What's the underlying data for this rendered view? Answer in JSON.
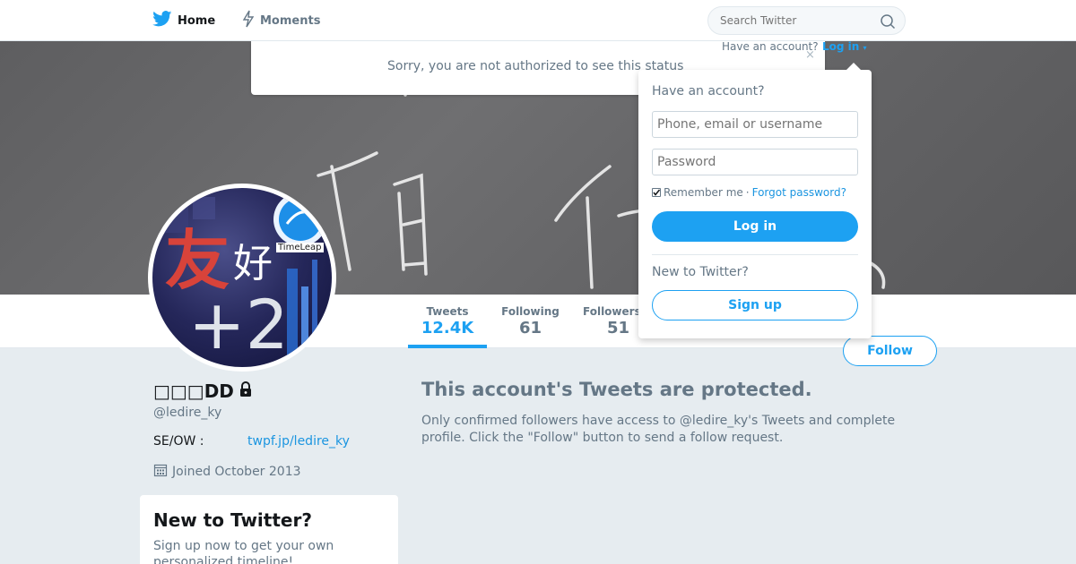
{
  "nav": {
    "home_label": "Home",
    "moments_label": "Moments",
    "search_placeholder": "Search Twitter"
  },
  "status": {
    "message": "Sorry, you are not authorized to see this status",
    "close_glyph": "×"
  },
  "login": {
    "have_account_inline": "Have an account?",
    "login_link": "Log in",
    "dropdown_title": "Have an account?",
    "username_placeholder": "Phone, email or username",
    "password_placeholder": "Password",
    "remember_me": "Remember me",
    "separator": "·",
    "forgot_password": "Forgot password?",
    "login_button": "Log in",
    "new_to_twitter": "New to Twitter?",
    "signup_button": "Sign up"
  },
  "stats": {
    "tweets": {
      "label": "Tweets",
      "value": "12.4K"
    },
    "following": {
      "label": "Following",
      "value": "61"
    },
    "followers": {
      "label": "Followers",
      "value": "51"
    }
  },
  "follow_button": "Follow",
  "profile": {
    "name": "□□□DD",
    "handle": "@ledire_ky",
    "bio_label": "SE/OW :",
    "bio_link": "twpf.jp/ledire_ky",
    "joined": "Joined October 2013"
  },
  "avatar_text": {
    "kanji_1": "友",
    "kanji_2": "好",
    "plus_two": "+2",
    "badge": "TimeLeap"
  },
  "new_card": {
    "title": "New to Twitter?",
    "body": "Sign up now to get your own personalized timeline!"
  },
  "protected": {
    "title": "This account's Tweets are protected.",
    "description": "Only confirmed followers have access to @ledire_ky's Tweets and complete profile. Click the \"Follow\" button to send a follow request."
  },
  "colors": {
    "accent": "#1da1f2",
    "background": "#e6ecf0",
    "muted_text": "#657786"
  }
}
